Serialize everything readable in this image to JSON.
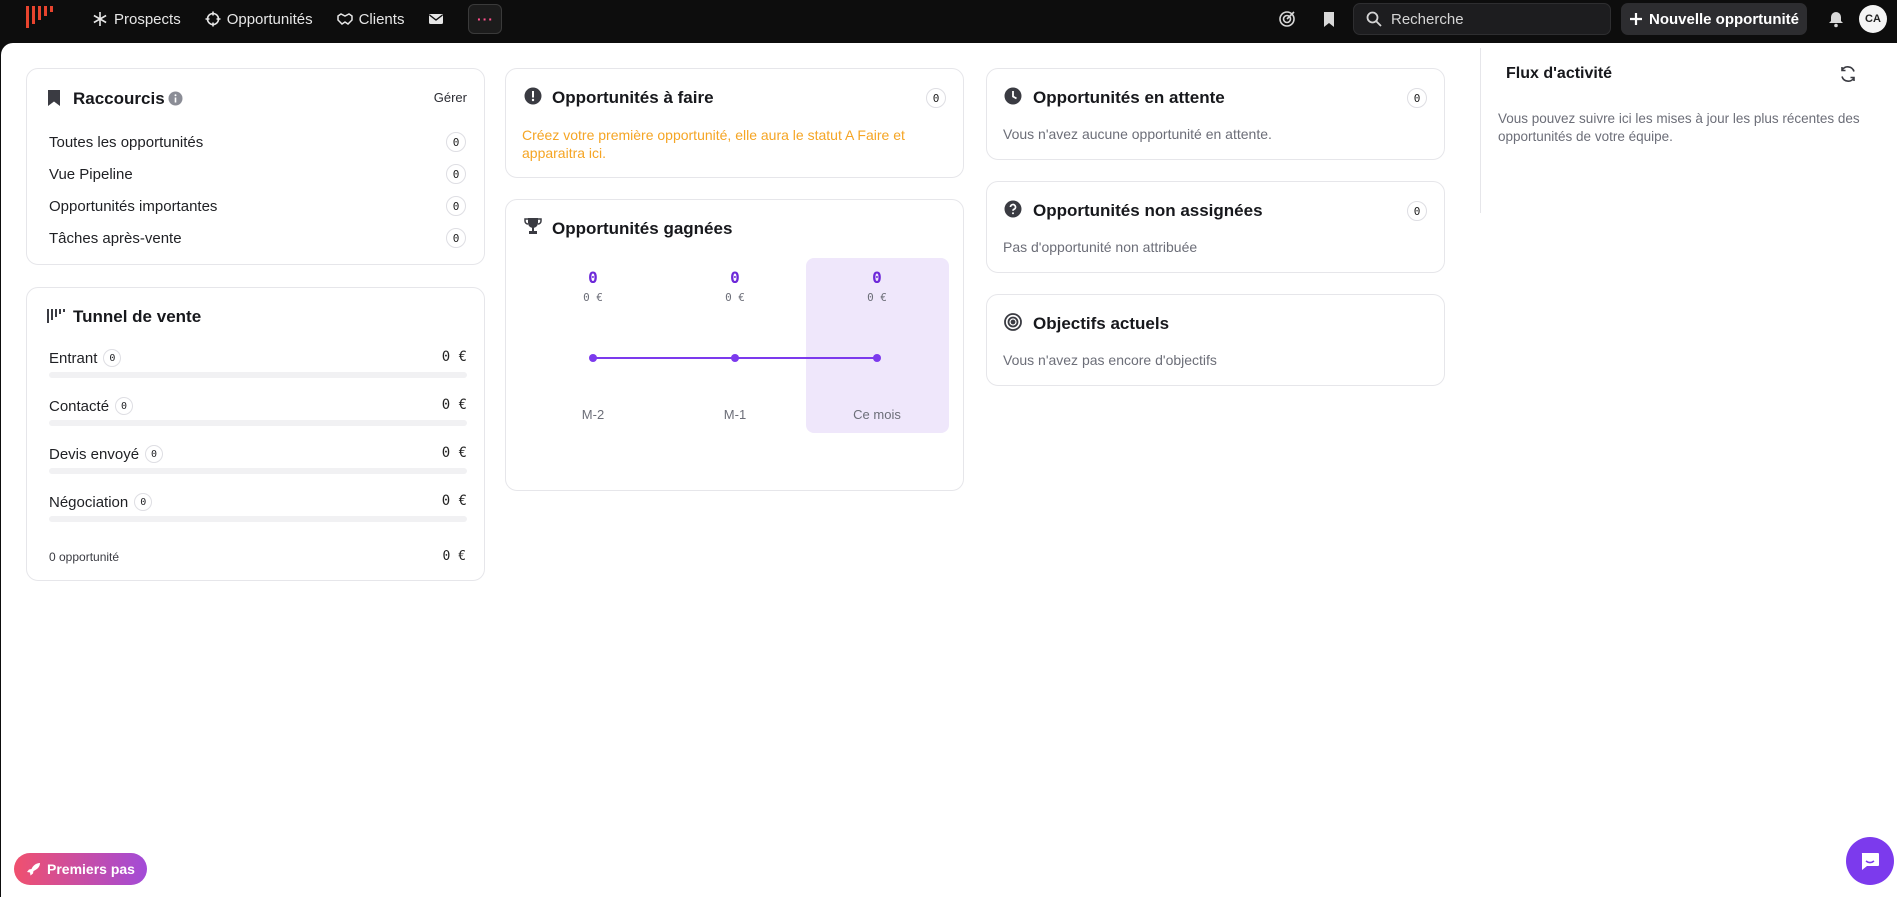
{
  "nav": {
    "items": [
      {
        "label": "Prospects",
        "icon": "snowflake-icon"
      },
      {
        "label": "Opportunités",
        "icon": "crosshair-icon"
      },
      {
        "label": "Clients",
        "icon": "handshake-icon"
      }
    ],
    "mail_icon": "mail-icon",
    "more_label": "···"
  },
  "topbar": {
    "search_placeholder": "Recherche",
    "new_opportunity_label": "Nouvelle opportunité",
    "avatar_initials": "CA"
  },
  "shortcuts": {
    "title": "Raccourcis",
    "manage_label": "Gérer",
    "items": [
      {
        "label": "Toutes les opportunités",
        "count": "0"
      },
      {
        "label": "Vue Pipeline",
        "count": "0"
      },
      {
        "label": "Opportunités importantes",
        "count": "0"
      },
      {
        "label": "Tâches après-vente",
        "count": "0"
      }
    ]
  },
  "funnel": {
    "title": "Tunnel de vente",
    "stages": [
      {
        "label": "Entrant",
        "count": "0",
        "amount": "0 €"
      },
      {
        "label": "Contacté",
        "count": "0",
        "amount": "0 €"
      },
      {
        "label": "Devis envoyé",
        "count": "0",
        "amount": "0 €"
      },
      {
        "label": "Négociation",
        "count": "0",
        "amount": "0 €"
      }
    ],
    "total_label": "0 opportunité",
    "total_amount": "0 €"
  },
  "todo": {
    "title": "Opportunités à faire",
    "count": "0",
    "message": "Créez votre première opportunité, elle aura le statut A Faire et apparaitra ici."
  },
  "won": {
    "title": "Opportunités gagnées",
    "columns": [
      {
        "month": "M-2",
        "count": "0",
        "amount": "0 €"
      },
      {
        "month": "M-1",
        "count": "0",
        "amount": "0 €"
      },
      {
        "month": "Ce mois",
        "count": "0",
        "amount": "0 €"
      }
    ]
  },
  "pending": {
    "title": "Opportunités en attente",
    "count": "0",
    "message": "Vous n'avez aucune opportunité en attente."
  },
  "unassigned": {
    "title": "Opportunités non assignées",
    "count": "0",
    "message": "Pas d'opportunité non attribuée"
  },
  "objectives": {
    "title": "Objectifs actuels",
    "message": "Vous n'avez pas encore d'objectifs"
  },
  "activity": {
    "title": "Flux d'activité",
    "message": "Vous pouvez suivre ici les mises à jour les plus récentes des opportunités de votre équipe."
  },
  "footer": {
    "onboarding_label": "Premiers pas"
  },
  "colors": {
    "accent_purple": "#6d28d9",
    "todo_orange": "#f5a524",
    "topbar_bg": "#0d0d0d"
  }
}
